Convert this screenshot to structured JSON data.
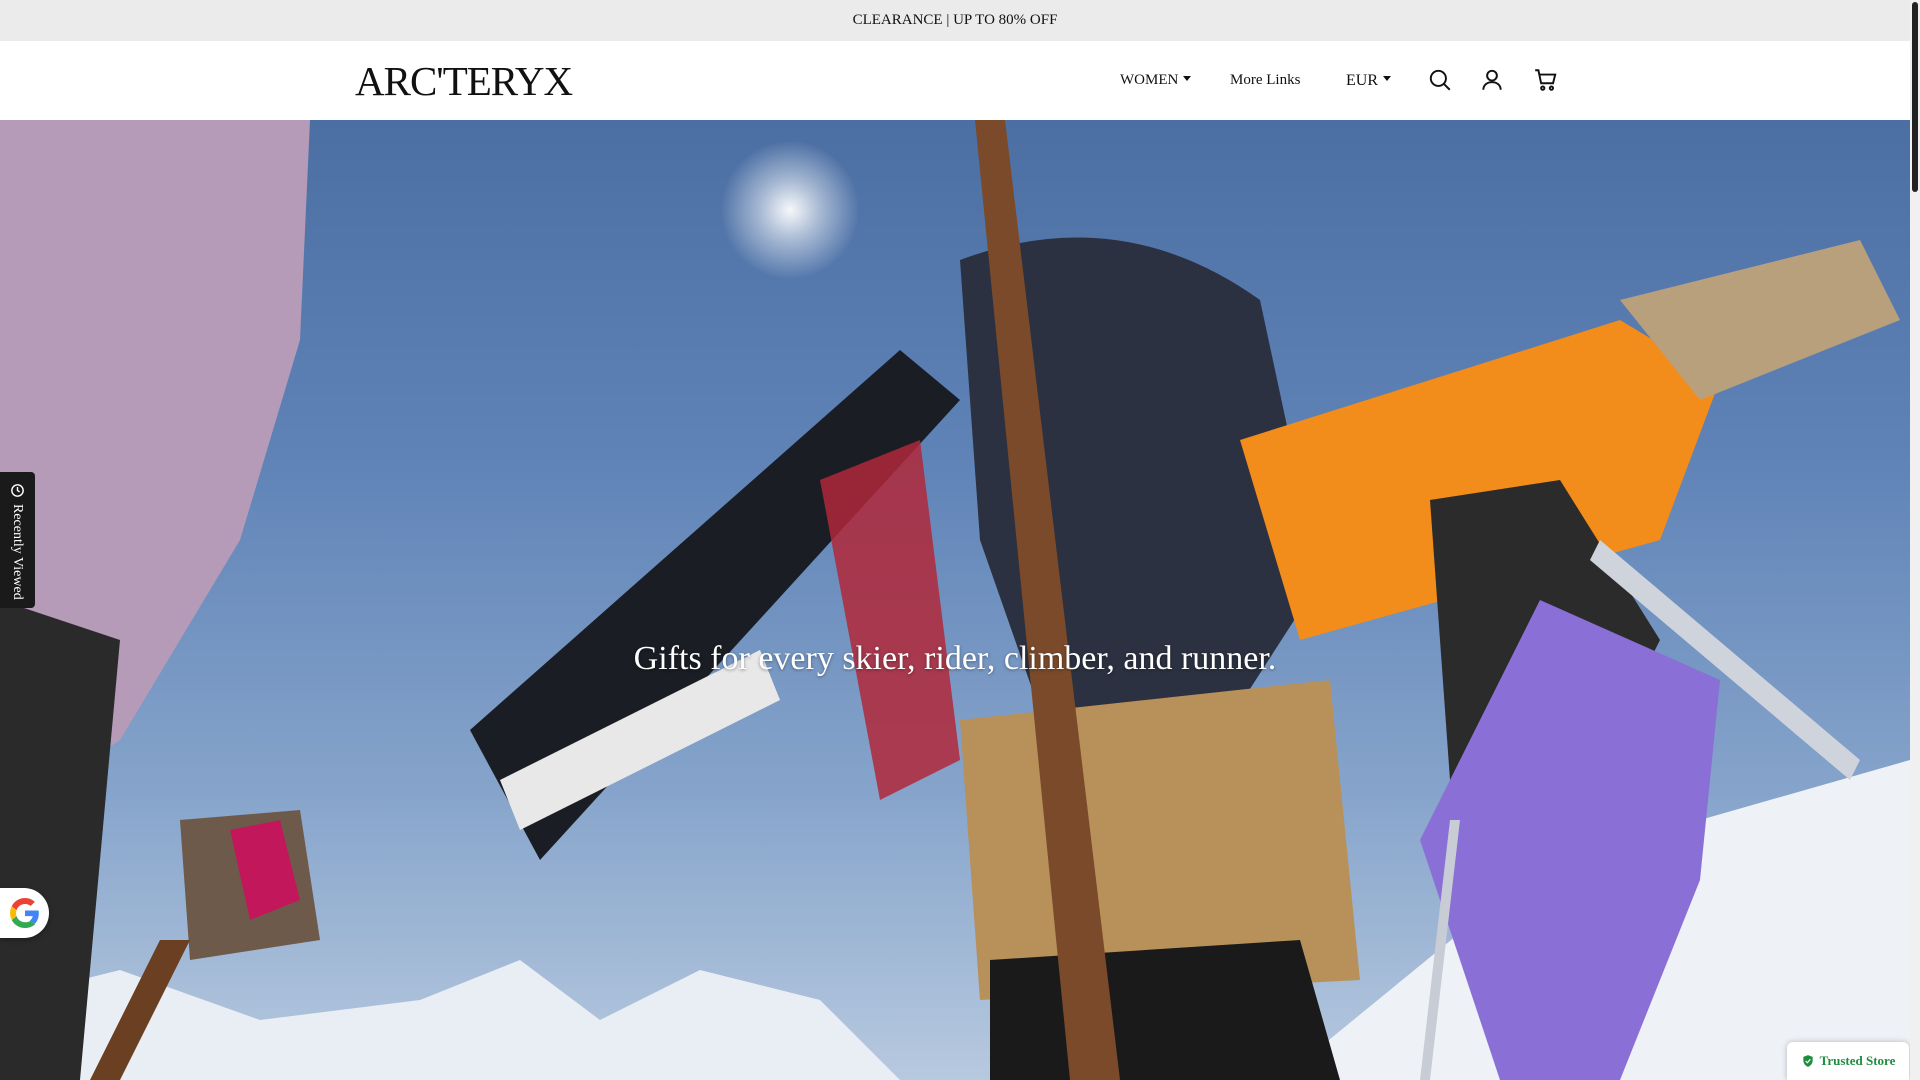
{
  "announcement": {
    "text": "CLEARANCE | UP TO 80% OFF"
  },
  "header": {
    "logo": "ARC'TERYX",
    "nav": {
      "women": "WOMEN",
      "more_links": "More Links"
    },
    "currency": "EUR",
    "icons": [
      "search-icon",
      "account-icon",
      "cart-icon"
    ]
  },
  "hero": {
    "headline": "Gifts for every skier, rider, climber, and runner."
  },
  "recently_viewed": {
    "label": "Recently Viewed"
  },
  "trusted_store": {
    "label": "Trusted Store"
  },
  "colors": {
    "announcement_bg": "#ebebeb",
    "trusted_green": "#1e8e3e",
    "sky": "#5f83b7"
  }
}
